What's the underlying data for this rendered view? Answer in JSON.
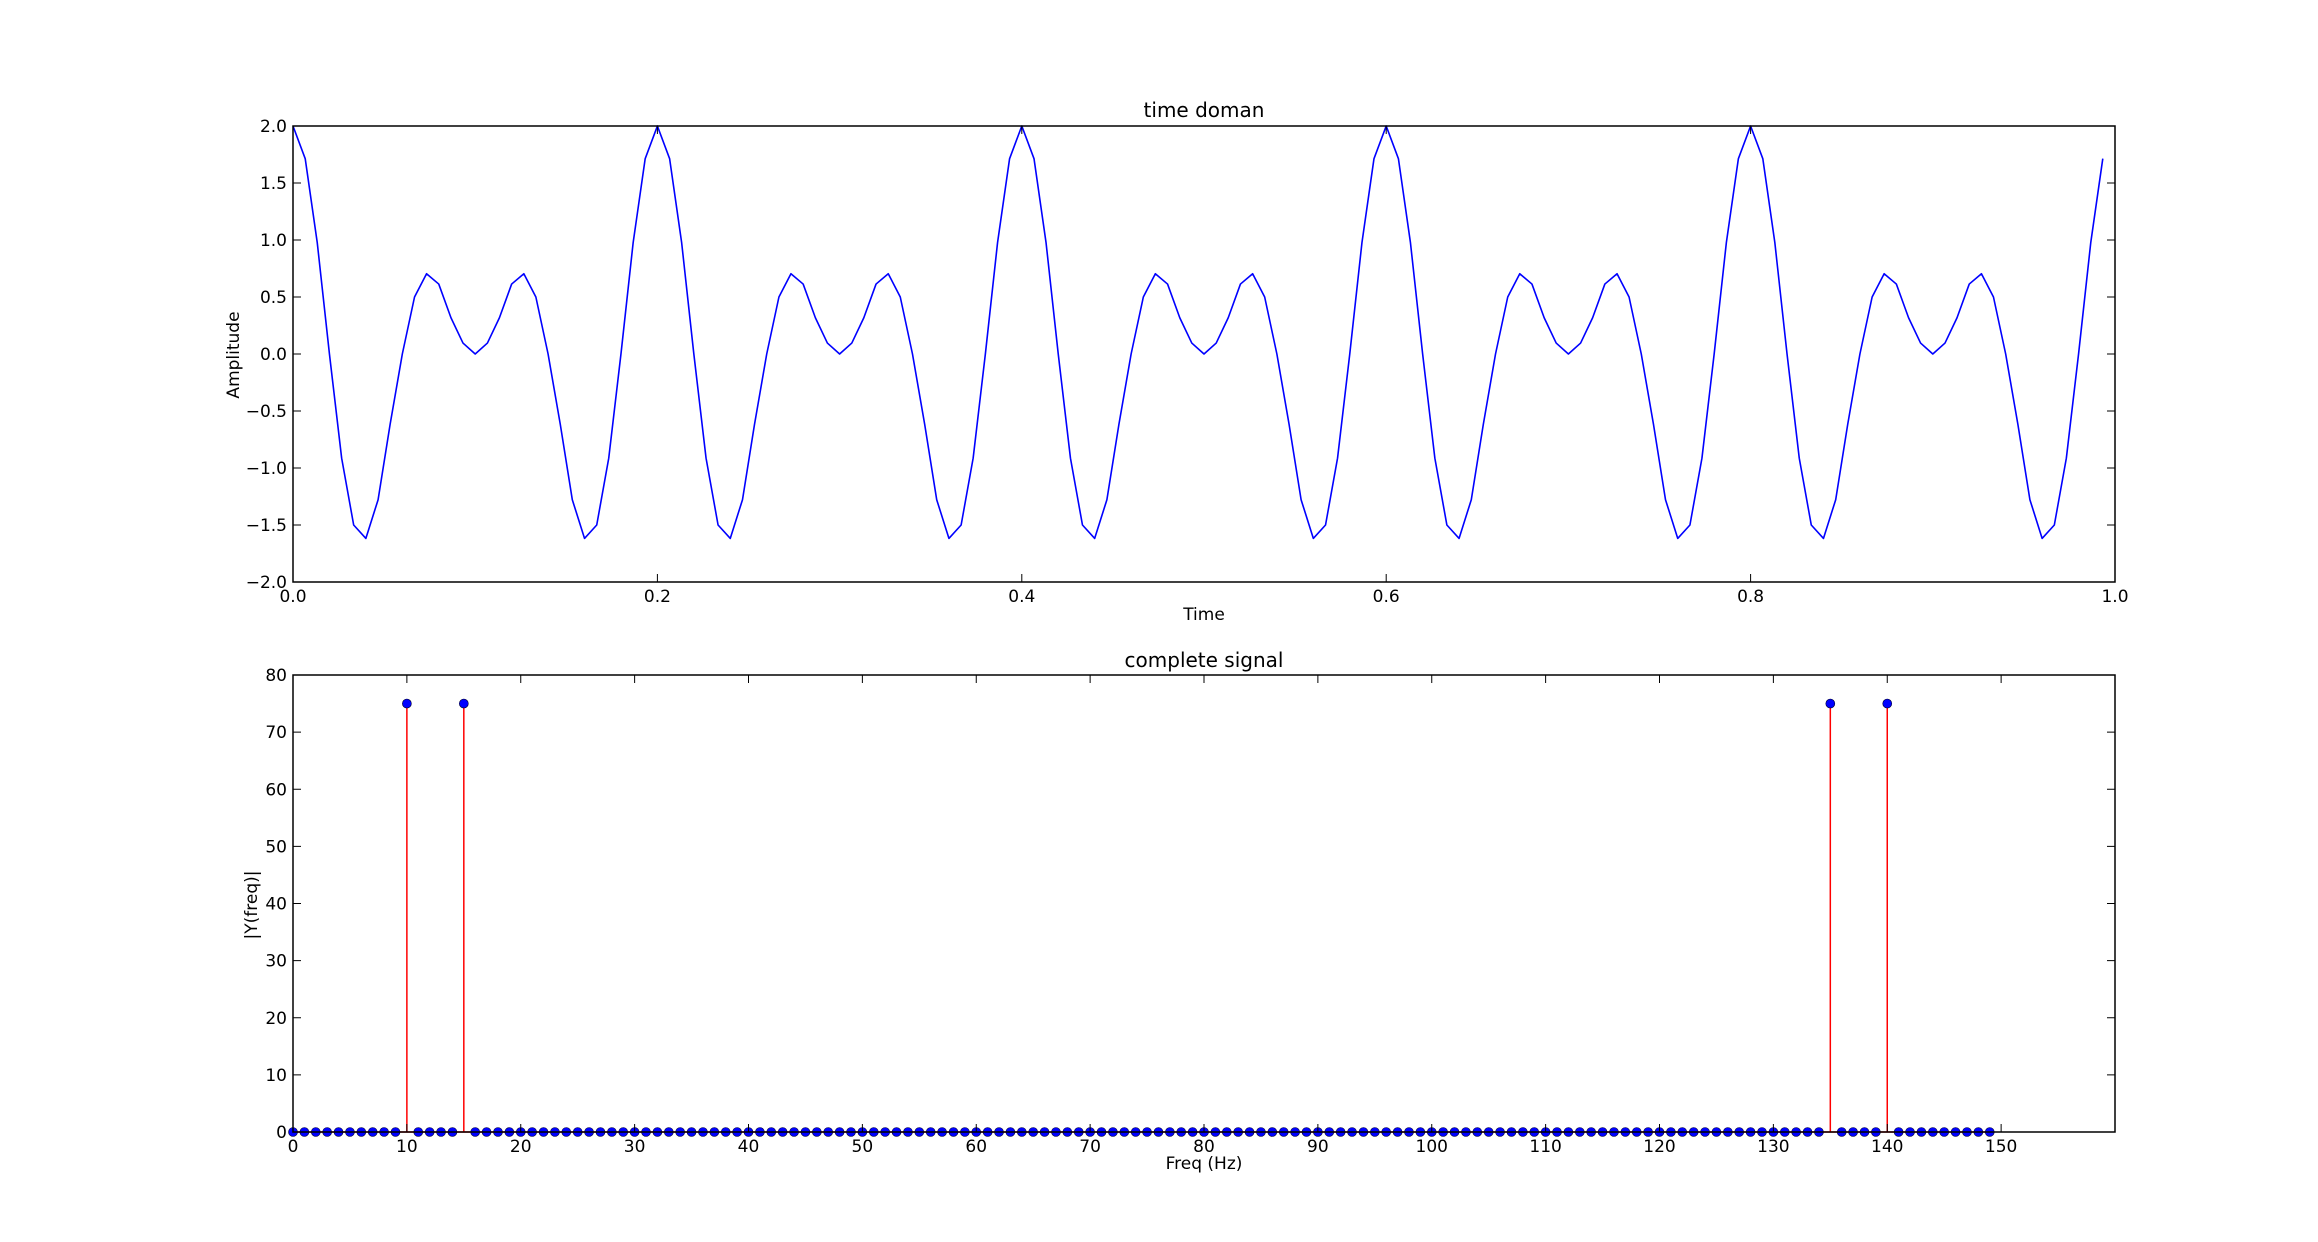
{
  "chart_data": [
    {
      "type": "line",
      "title": "time doman",
      "xlabel": "Time",
      "ylabel": "Amplitude",
      "xlim": [
        0.0,
        1.0
      ],
      "ylim": [
        -2.0,
        2.0
      ],
      "xticks": [
        "0.0",
        "0.2",
        "0.4",
        "0.6",
        "0.8",
        "1.0"
      ],
      "yticks": [
        "−2.0",
        "−1.5",
        "−1.0",
        "−0.5",
        "0.0",
        "0.5",
        "1.0",
        "1.5",
        "2.0"
      ],
      "grid": false,
      "series": [
        {
          "color": "#0000ff",
          "x": [
            0.0,
            0.0067,
            0.0133,
            0.02,
            0.0267,
            0.0333,
            0.04,
            0.0467,
            0.0533,
            0.06,
            0.0667,
            0.0733,
            0.08,
            0.0867,
            0.0933,
            0.1,
            0.1067,
            0.1133,
            0.12,
            0.1267,
            0.1333,
            0.14,
            0.1467,
            0.1533,
            0.16,
            0.1667,
            0.1733,
            0.18,
            0.1867,
            0.1933,
            0.2,
            0.2067,
            0.2133,
            0.22,
            0.2267,
            0.2333,
            0.24,
            0.2467,
            0.2533,
            0.26,
            0.2667,
            0.2733,
            0.28,
            0.2867,
            0.2933,
            0.3,
            0.3067,
            0.3133,
            0.32,
            0.3267,
            0.3333,
            0.34,
            0.3467,
            0.3533,
            0.36,
            0.3667,
            0.3733,
            0.38,
            0.3867,
            0.3933,
            0.4,
            0.4067,
            0.4133,
            0.42,
            0.4267,
            0.4333,
            0.44,
            0.4467,
            0.4533,
            0.46,
            0.4667,
            0.4733,
            0.48,
            0.4867,
            0.4933,
            0.5,
            0.5067,
            0.5133,
            0.52,
            0.5267,
            0.5333,
            0.54,
            0.5467,
            0.5533,
            0.56,
            0.5667,
            0.5733,
            0.58,
            0.5867,
            0.5933,
            0.6,
            0.6067,
            0.6133,
            0.62,
            0.6267,
            0.6333,
            0.64,
            0.6467,
            0.6533,
            0.66,
            0.6667,
            0.6733,
            0.68,
            0.6867,
            0.6933,
            0.7,
            0.7067,
            0.7133,
            0.72,
            0.7267,
            0.7333,
            0.74,
            0.7467,
            0.7533,
            0.76,
            0.7667,
            0.7733,
            0.78,
            0.7867,
            0.7933,
            0.8,
            0.8067,
            0.8133,
            0.82,
            0.8267,
            0.8333,
            0.84,
            0.8467,
            0.8533,
            0.86,
            0.8667,
            0.8733,
            0.88,
            0.8867,
            0.8933,
            0.9,
            0.9067,
            0.9133,
            0.92,
            0.9267,
            0.9333,
            0.94,
            0.9467,
            0.9533,
            0.96,
            0.9667,
            0.9733,
            0.98,
            0.9867,
            0.9933
          ],
          "y": [
            2.0,
            1.7135,
            0.9781,
            0.0,
            -0.9135,
            -1.5,
            -1.6177,
            -1.2781,
            -0.6177,
            0.0,
            0.5,
            0.7042,
            0.6135,
            0.3177,
            0.0958,
            0.0,
            0.0958,
            0.3177,
            0.6135,
            0.7042,
            0.5,
            0.0,
            -0.6177,
            -1.2781,
            -1.6177,
            -1.5,
            -0.9135,
            0.0,
            0.9781,
            1.7135,
            2.0,
            1.7135,
            0.9781,
            0.0,
            -0.9135,
            -1.5,
            -1.6177,
            -1.2781,
            -0.6177,
            0.0,
            0.5,
            0.7042,
            0.6135,
            0.3177,
            0.0958,
            0.0,
            0.0958,
            0.3177,
            0.6135,
            0.7042,
            0.5,
            0.0,
            -0.6177,
            -1.2781,
            -1.6177,
            -1.5,
            -0.9135,
            0.0,
            0.9781,
            1.7135,
            2.0,
            1.7135,
            0.9781,
            0.0,
            -0.9135,
            -1.5,
            -1.6177,
            -1.2781,
            -0.6177,
            0.0,
            0.5,
            0.7042,
            0.6135,
            0.3177,
            0.0958,
            0.0,
            0.0958,
            0.3177,
            0.6135,
            0.7042,
            0.5,
            0.0,
            -0.6177,
            -1.2781,
            -1.6177,
            -1.5,
            -0.9135,
            0.0,
            0.9781,
            1.7135,
            2.0,
            1.7135,
            0.9781,
            0.0,
            -0.9135,
            -1.5,
            -1.6177,
            -1.2781,
            -0.6177,
            0.0,
            0.5,
            0.7042,
            0.6135,
            0.3177,
            0.0958,
            0.0,
            0.0958,
            0.3177,
            0.6135,
            0.7042,
            0.5,
            0.0,
            -0.6177,
            -1.2781,
            -1.6177,
            -1.5,
            -0.9135,
            0.0,
            0.9781,
            1.7135,
            2.0,
            1.7135,
            0.9781,
            0.0,
            -0.9135,
            -1.5,
            -1.6177,
            -1.2781,
            -0.6177,
            0.0,
            0.5,
            0.7042,
            0.6135,
            0.3177,
            0.0958,
            0.0,
            0.0958,
            0.3177,
            0.6135,
            0.7042,
            0.5,
            0.0,
            -0.6177,
            -1.2781,
            -1.6177,
            -1.5,
            -0.9135,
            0.0,
            0.9781,
            1.7135
          ]
        }
      ]
    },
    {
      "type": "stem",
      "title": "complete signal",
      "xlabel": "Freq (Hz)",
      "ylabel": "|Y(freq)|",
      "xlim": [
        0,
        160
      ],
      "ylim": [
        0,
        80
      ],
      "xticks": [
        "0",
        "10",
        "20",
        "30",
        "40",
        "50",
        "60",
        "70",
        "80",
        "90",
        "100",
        "110",
        "120",
        "130",
        "140",
        "150"
      ],
      "yticks": [
        "0",
        "10",
        "20",
        "30",
        "40",
        "50",
        "60",
        "70",
        "80"
      ],
      "grid": false,
      "stem_color": "#ff0000",
      "marker_color": "#0000ff",
      "series": [
        {
          "x": [
            0,
            1,
            2,
            3,
            4,
            5,
            6,
            7,
            8,
            9,
            10,
            11,
            12,
            13,
            14,
            15,
            16,
            17,
            18,
            19,
            20,
            21,
            22,
            23,
            24,
            25,
            26,
            27,
            28,
            29,
            30,
            31,
            32,
            33,
            34,
            35,
            36,
            37,
            38,
            39,
            40,
            41,
            42,
            43,
            44,
            45,
            46,
            47,
            48,
            49,
            50,
            51,
            52,
            53,
            54,
            55,
            56,
            57,
            58,
            59,
            60,
            61,
            62,
            63,
            64,
            65,
            66,
            67,
            68,
            69,
            70,
            71,
            72,
            73,
            74,
            75,
            76,
            77,
            78,
            79,
            80,
            81,
            82,
            83,
            84,
            85,
            86,
            87,
            88,
            89,
            90,
            91,
            92,
            93,
            94,
            95,
            96,
            97,
            98,
            99,
            100,
            101,
            102,
            103,
            104,
            105,
            106,
            107,
            108,
            109,
            110,
            111,
            112,
            113,
            114,
            115,
            116,
            117,
            118,
            119,
            120,
            121,
            122,
            123,
            124,
            125,
            126,
            127,
            128,
            129,
            130,
            131,
            132,
            133,
            134,
            135,
            136,
            137,
            138,
            139,
            140,
            141,
            142,
            143,
            144,
            145,
            146,
            147,
            148,
            149
          ],
          "y": [
            0,
            0,
            0,
            0,
            0,
            0,
            0,
            0,
            0,
            0,
            75,
            0,
            0,
            0,
            0,
            75,
            0,
            0,
            0,
            0,
            0,
            0,
            0,
            0,
            0,
            0,
            0,
            0,
            0,
            0,
            0,
            0,
            0,
            0,
            0,
            0,
            0,
            0,
            0,
            0,
            0,
            0,
            0,
            0,
            0,
            0,
            0,
            0,
            0,
            0,
            0,
            0,
            0,
            0,
            0,
            0,
            0,
            0,
            0,
            0,
            0,
            0,
            0,
            0,
            0,
            0,
            0,
            0,
            0,
            0,
            0,
            0,
            0,
            0,
            0,
            0,
            0,
            0,
            0,
            0,
            0,
            0,
            0,
            0,
            0,
            0,
            0,
            0,
            0,
            0,
            0,
            0,
            0,
            0,
            0,
            0,
            0,
            0,
            0,
            0,
            0,
            0,
            0,
            0,
            0,
            0,
            0,
            0,
            0,
            0,
            0,
            0,
            0,
            0,
            0,
            0,
            0,
            0,
            0,
            0,
            0,
            0,
            0,
            0,
            0,
            0,
            0,
            0,
            0,
            0,
            0,
            0,
            0,
            0,
            0,
            75,
            0,
            0,
            0,
            0,
            75,
            0,
            0,
            0,
            0,
            0,
            0,
            0,
            0,
            0
          ]
        }
      ]
    }
  ]
}
